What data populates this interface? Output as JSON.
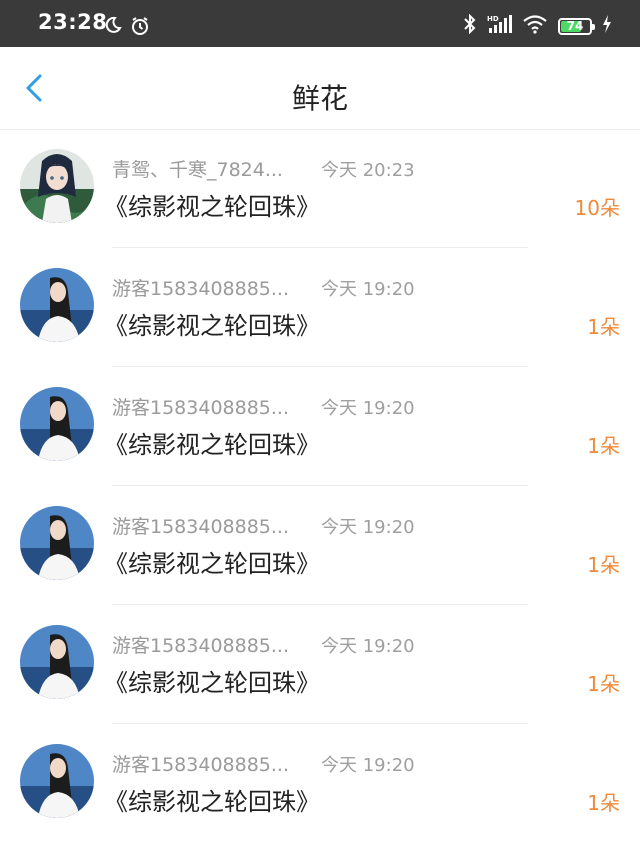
{
  "status_bar": {
    "time": "23:28",
    "battery": "74",
    "battery_level": 0.74,
    "icons": [
      "moon-icon",
      "alarm-icon",
      "bluetooth-icon",
      "hd-signal-icon",
      "wifi-icon",
      "battery-icon",
      "charging-icon"
    ]
  },
  "header": {
    "title": "鲜花",
    "back_icon": "chevron-left-icon"
  },
  "colors": {
    "accent": "#2f9ee6",
    "count": "#f0893a",
    "muted": "#9a9a9a"
  },
  "items": [
    {
      "name": "青鸳、千寒_7824...",
      "time": "今天 20:23",
      "book": "《综影视之轮回珠》",
      "count": "10朵",
      "avatar": "anime-avatar"
    },
    {
      "name": "游客1583408885...",
      "time": "今天 19:20",
      "book": "《综影视之轮回珠》",
      "count": "1朵",
      "avatar": "photo-avatar"
    },
    {
      "name": "游客1583408885...",
      "time": "今天 19:20",
      "book": "《综影视之轮回珠》",
      "count": "1朵",
      "avatar": "photo-avatar"
    },
    {
      "name": "游客1583408885...",
      "time": "今天 19:20",
      "book": "《综影视之轮回珠》",
      "count": "1朵",
      "avatar": "photo-avatar"
    },
    {
      "name": "游客1583408885...",
      "time": "今天 19:20",
      "book": "《综影视之轮回珠》",
      "count": "1朵",
      "avatar": "photo-avatar"
    },
    {
      "name": "游客1583408885...",
      "time": "今天 19:20",
      "book": "《综影视之轮回珠》",
      "count": "1朵",
      "avatar": "photo-avatar"
    }
  ]
}
